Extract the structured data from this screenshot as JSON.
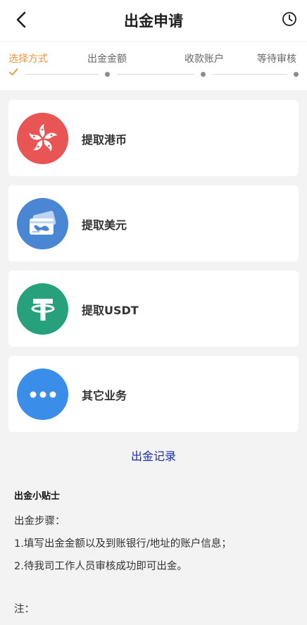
{
  "header": {
    "title": "出金申请"
  },
  "steps": [
    {
      "label": "选择方式"
    },
    {
      "label": "出金金额"
    },
    {
      "label": "收款账户"
    },
    {
      "label": "等待审核"
    }
  ],
  "methods": [
    {
      "label": "提取港币",
      "icon": "hk-bauhinia-icon",
      "color": "#e95454"
    },
    {
      "label": "提取美元",
      "icon": "bank-card-icon",
      "color": "#4a86d4"
    },
    {
      "label": "提取USDT",
      "icon": "tether-icon",
      "color": "#26a17b"
    },
    {
      "label": "其它业务",
      "icon": "more-dots-icon",
      "color": "#3b8dea"
    }
  ],
  "records_link": "出金记录",
  "tips": {
    "title": "出金小贴士",
    "steps_heading": "出金步骤：",
    "step1": "1.填写出金金额以及到账银行/地址的账户信息；",
    "step2": "2.待我司工作人员审核成功即可出金。",
    "note_heading": "注："
  },
  "colors": {
    "accent": "#f0933c",
    "link": "#1a2bb5"
  }
}
